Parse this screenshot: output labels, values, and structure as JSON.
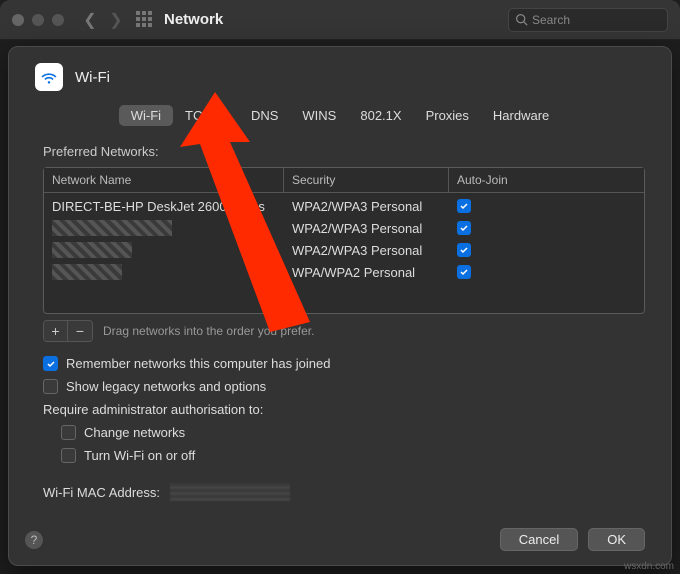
{
  "titlebar": {
    "title": "Network",
    "search_placeholder": "Search"
  },
  "sheet": {
    "title": "Wi-Fi",
    "tabs": [
      "Wi-Fi",
      "TCP/IP",
      "DNS",
      "WINS",
      "802.1X",
      "Proxies",
      "Hardware"
    ],
    "active_tab": 0,
    "preferred_label": "Preferred Networks:",
    "columns": {
      "name": "Network Name",
      "security": "Security",
      "auto": "Auto-Join"
    },
    "rows": [
      {
        "name": "DIRECT-BE-HP DeskJet 2600 series",
        "security": "WPA2/WPA3 Personal",
        "auto": true,
        "redacted": false
      },
      {
        "name": "",
        "security": "WPA2/WPA3 Personal",
        "auto": true,
        "redacted": true
      },
      {
        "name": "",
        "security": "WPA2/WPA3 Personal",
        "auto": true,
        "redacted": true
      },
      {
        "name": "",
        "security": "WPA/WPA2 Personal",
        "auto": true,
        "redacted": true
      }
    ],
    "drag_hint": "Drag networks into the order you prefer.",
    "remember_label": "Remember networks this computer has joined",
    "legacy_label": "Show legacy networks and options",
    "require_label": "Require administrator authorisation to:",
    "change_networks_label": "Change networks",
    "turn_wifi_label": "Turn Wi-Fi on or off",
    "mac_label": "Wi-Fi MAC Address:",
    "cancel": "Cancel",
    "ok": "OK"
  },
  "watermark": "wsxdn.com"
}
